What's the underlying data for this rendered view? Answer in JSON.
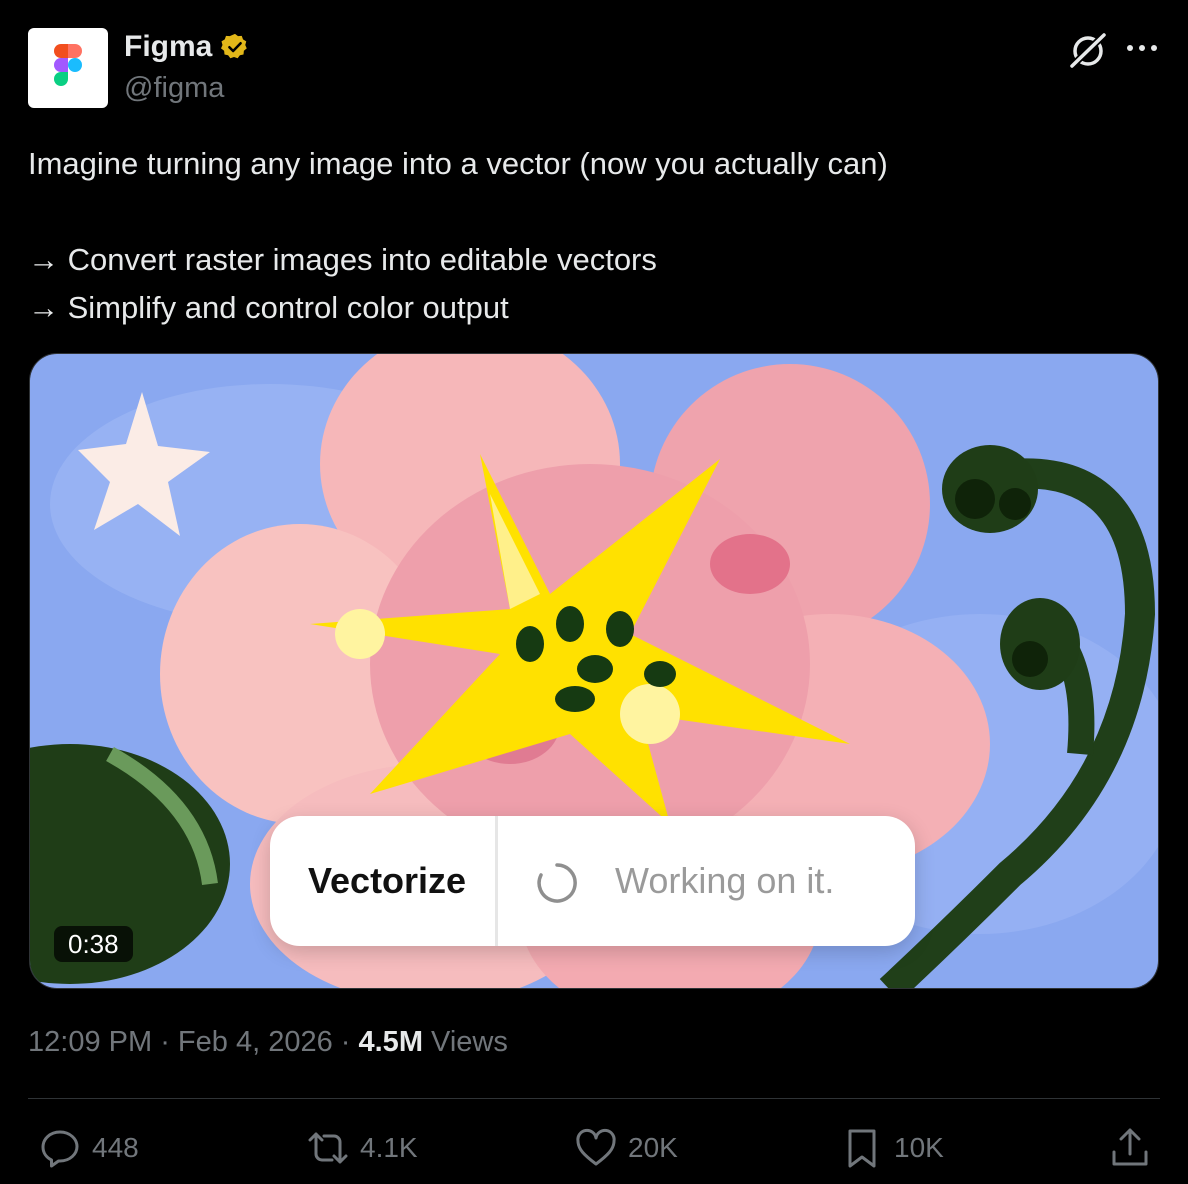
{
  "author": {
    "display_name": "Figma",
    "handle": "@figma",
    "verified": true,
    "verified_color": "#e2b719"
  },
  "tweet": {
    "text": "Imagine turning any image into a vector (now you actually can)\n\n→ Convert raster images into editable vectors\n→ Simplify and control color output"
  },
  "media": {
    "type": "video",
    "duration": "0:38",
    "overlay": {
      "action_label": "Vectorize",
      "status_label": "Working on it."
    }
  },
  "meta": {
    "time": "12:09 PM",
    "separator": " · ",
    "date": "Feb 4, 2026",
    "views_count": "4.5M",
    "views_label": " Views"
  },
  "actions": {
    "replies": "448",
    "reposts": "4.1K",
    "likes": "20K",
    "bookmarks": "10K"
  },
  "icons": [
    "figma-logo-icon",
    "verified-badge-icon",
    "grok-icon",
    "more-icon",
    "reply-icon",
    "repost-icon",
    "like-icon",
    "bookmark-icon",
    "share-icon",
    "spinner-icon"
  ],
  "colors": {
    "background": "#000000",
    "text": "#e7e9ea",
    "muted": "#71767b",
    "border": "#2f3336"
  }
}
